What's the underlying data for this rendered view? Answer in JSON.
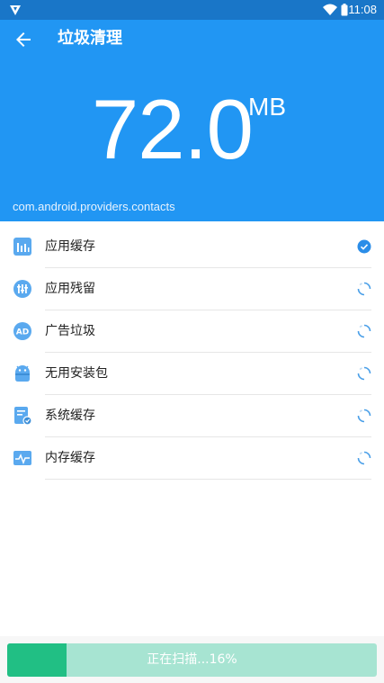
{
  "status_bar": {
    "time": "11:08",
    "icons": [
      "app-badge-icon",
      "wifi-icon",
      "battery-icon"
    ]
  },
  "header": {
    "title": "垃圾清理",
    "size_value": "72.0",
    "size_unit": "MB",
    "package_name": "com.android.providers.contacts",
    "color": "#2196f3"
  },
  "categories": [
    {
      "label": "应用缓存",
      "icon": "app-cache-icon",
      "state": "done"
    },
    {
      "label": "应用残留",
      "icon": "app-residue-icon",
      "state": "scanning"
    },
    {
      "label": "广告垃圾",
      "icon": "ad-junk-icon",
      "state": "scanning"
    },
    {
      "label": "无用安装包",
      "icon": "apk-package-icon",
      "state": "scanning"
    },
    {
      "label": "系统缓存",
      "icon": "system-cache-icon",
      "state": "scanning"
    },
    {
      "label": "内存缓存",
      "icon": "memory-cache-icon",
      "state": "scanning"
    }
  ],
  "progress": {
    "text": "正在扫描...16%",
    "percent": 16,
    "fill_color": "#21bf84",
    "track_color": "#a7e4d2"
  }
}
